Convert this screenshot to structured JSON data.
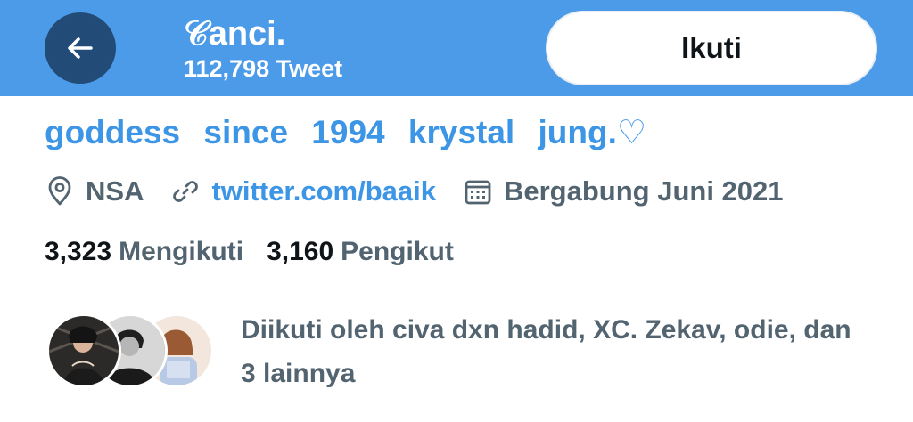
{
  "header": {
    "name": "𝒞anci.",
    "tweet_count": "112,798 Tweet",
    "follow_label": "Ikuti",
    "background_color": "#4c9be8"
  },
  "profile": {
    "bio": "goddess since 1994 krystal jung.♡",
    "location": "NSA",
    "website": "twitter.com/baaik",
    "joined": "Bergabung Juni 2021",
    "accent_color": "#3d95e6"
  },
  "stats": {
    "following_count": "3,323",
    "following_label": "Mengikuti",
    "followers_count": "3,160",
    "followers_label": "Pengikut"
  },
  "followed_by": {
    "text": "Diikuti oleh civa dxn hadid, XC. Zekav, odie, dan 3 lainnya"
  },
  "icons": {
    "back": "arrow-left-icon",
    "location": "location-pin-icon",
    "link": "link-icon",
    "calendar": "calendar-icon"
  }
}
